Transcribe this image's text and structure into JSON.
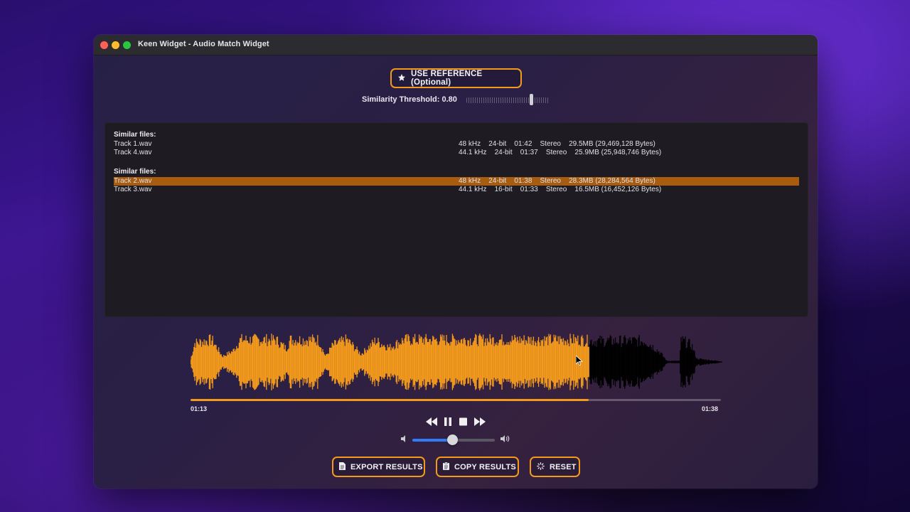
{
  "window": {
    "title": "Keen Widget - Audio Match Widget"
  },
  "reference_button": {
    "label": "USE REFERENCE (Optional)",
    "icon": "star-icon"
  },
  "threshold": {
    "label": "Similarity Threshold: 0.80",
    "value": 0.8
  },
  "groups": [
    {
      "heading": "Similar files:",
      "files": [
        {
          "name": "Track 1.wav",
          "info": "48 kHz    24-bit    01:42    Stereo    29.5MB (29,469,128 Bytes)",
          "selected": false
        },
        {
          "name": "Track 4.wav",
          "info": "44.1 kHz    24-bit    01:37    Stereo    25.9MB (25,948,746 Bytes)",
          "selected": false
        }
      ]
    },
    {
      "heading": "Similar files:",
      "files": [
        {
          "name": "Track 2.wav",
          "info": "48 kHz    24-bit    01:38    Stereo    28.3MB (28,284,564 Bytes)",
          "selected": true
        },
        {
          "name": "Track 3.wav",
          "info": "44.1 kHz    16-bit    01:33    Stereo    16.5MB (16,452,126 Bytes)",
          "selected": false
        }
      ]
    }
  ],
  "player": {
    "current_time": "01:13",
    "total_time": "01:38",
    "progress": 0.75,
    "volume": 0.5,
    "played_color": "#f39a1c",
    "unplayed_color": "#000000"
  },
  "actions": {
    "export_label": "EXPORT RESULTS",
    "copy_label": "COPY RESULTS",
    "reset_label": "RESET"
  }
}
